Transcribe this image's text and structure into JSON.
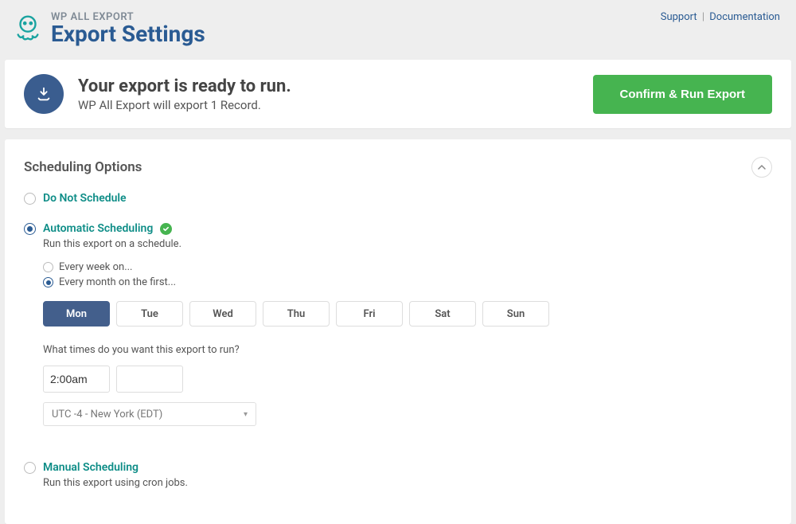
{
  "header": {
    "brand_small": "WP ALL EXPORT",
    "brand_large": "Export Settings",
    "support": "Support",
    "documentation": "Documentation"
  },
  "ready": {
    "title": "Your export is ready to run.",
    "subtitle": "WP All Export will export 1 Record.",
    "confirm_label": "Confirm & Run Export"
  },
  "sched": {
    "title": "Scheduling Options",
    "do_not_schedule": "Do Not Schedule",
    "auto_label": "Automatic Scheduling",
    "auto_desc": "Run this export on a schedule.",
    "freq_week": "Every week on...",
    "freq_month": "Every month on the first...",
    "days": [
      "Mon",
      "Tue",
      "Wed",
      "Thu",
      "Fri",
      "Sat",
      "Sun"
    ],
    "active_day_index": 0,
    "times_q": "What times do you want this export to run?",
    "time_value": "2:00am",
    "timezone": "UTC -4 - New York (EDT)",
    "manual_label": "Manual Scheduling",
    "manual_desc": "Run this export using cron jobs."
  }
}
